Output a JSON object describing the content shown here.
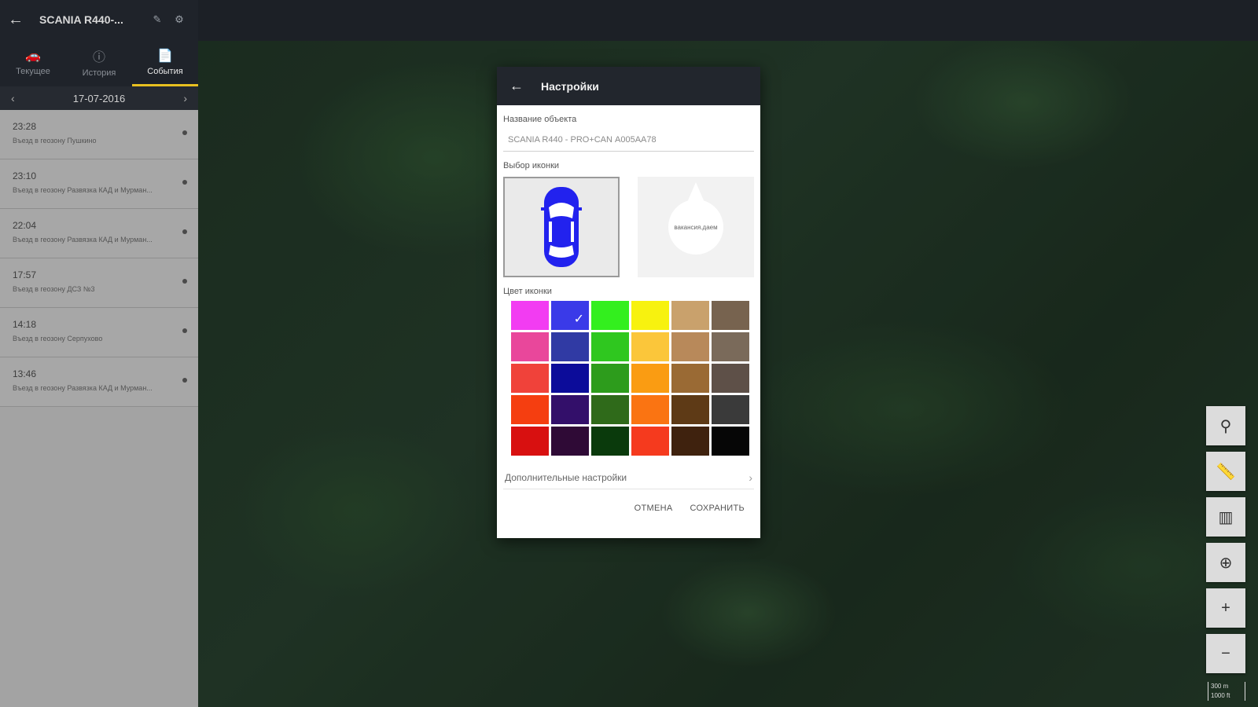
{
  "header": {
    "title": "SCANIA R440-...",
    "back_icon": "←",
    "edit_icon": "✎",
    "settings_icon": "⚙"
  },
  "tabs": [
    {
      "label": "Текущее",
      "icon": "🚗"
    },
    {
      "label": "История",
      "icon": "ⓘ"
    },
    {
      "label": "События",
      "icon": "📄"
    }
  ],
  "date_bar": {
    "date": "17-07-2016",
    "prev": "‹",
    "next": "›"
  },
  "events": [
    {
      "time": "23:28",
      "desc": "Въезд в геозону Пушкино"
    },
    {
      "time": "23:10",
      "desc": "Въезд в геозону Развязка КАД и Мурман..."
    },
    {
      "time": "22:04",
      "desc": "Въезд в геозону Развязка КАД и Мурман..."
    },
    {
      "time": "17:57",
      "desc": "Въезд в геозону ДСЗ №3"
    },
    {
      "time": "14:18",
      "desc": "Въезд в геозону Серпухово"
    },
    {
      "time": "13:46",
      "desc": "Въезд в геозону Развязка КАД и Мурман..."
    }
  ],
  "dialog": {
    "title": "Настройки",
    "back_icon": "←",
    "name_label": "Название объекта",
    "name_value": "SCANIA R440 - PRO+CAN А005АА78",
    "icon_label": "Выбор иконки",
    "other_icon_text": "вакансия.даем",
    "color_label": "Цвет иконки",
    "colors": [
      "#f23cf2",
      "#3a3ae8",
      "#33ef1e",
      "#f7f20f",
      "#c9a16c",
      "#77634f",
      "#e9479b",
      "#303aa4",
      "#2fc71f",
      "#fbc63a",
      "#b8895a",
      "#7a6a5a",
      "#f0423a",
      "#0c0c9a",
      "#2d9c1c",
      "#fa9c12",
      "#9a6a34",
      "#5e5048",
      "#f53e10",
      "#330f6a",
      "#2f6a1a",
      "#fa7412",
      "#5e3a16",
      "#3a3a3a",
      "#d81010",
      "#2f0a36",
      "#0a3a0c",
      "#f53a1e",
      "#3f220e",
      "#060606"
    ],
    "selected_check": "✓",
    "advanced_label": "Дополнительные настройки",
    "advanced_chevron": "›",
    "cancel_label": "ОТМЕНА",
    "save_label": "СОХРАНИТЬ"
  },
  "tools": [
    {
      "name": "track-tool",
      "icon": "⚲"
    },
    {
      "name": "ruler-tool",
      "icon": "📏"
    },
    {
      "name": "map-layers-tool",
      "icon": "▥"
    },
    {
      "name": "locate-tool",
      "icon": "⊕"
    },
    {
      "name": "zoom-in-tool",
      "icon": "+"
    },
    {
      "name": "zoom-out-tool",
      "icon": "−"
    }
  ],
  "scale": {
    "line1": "300 m",
    "line2": "1000 ft"
  }
}
